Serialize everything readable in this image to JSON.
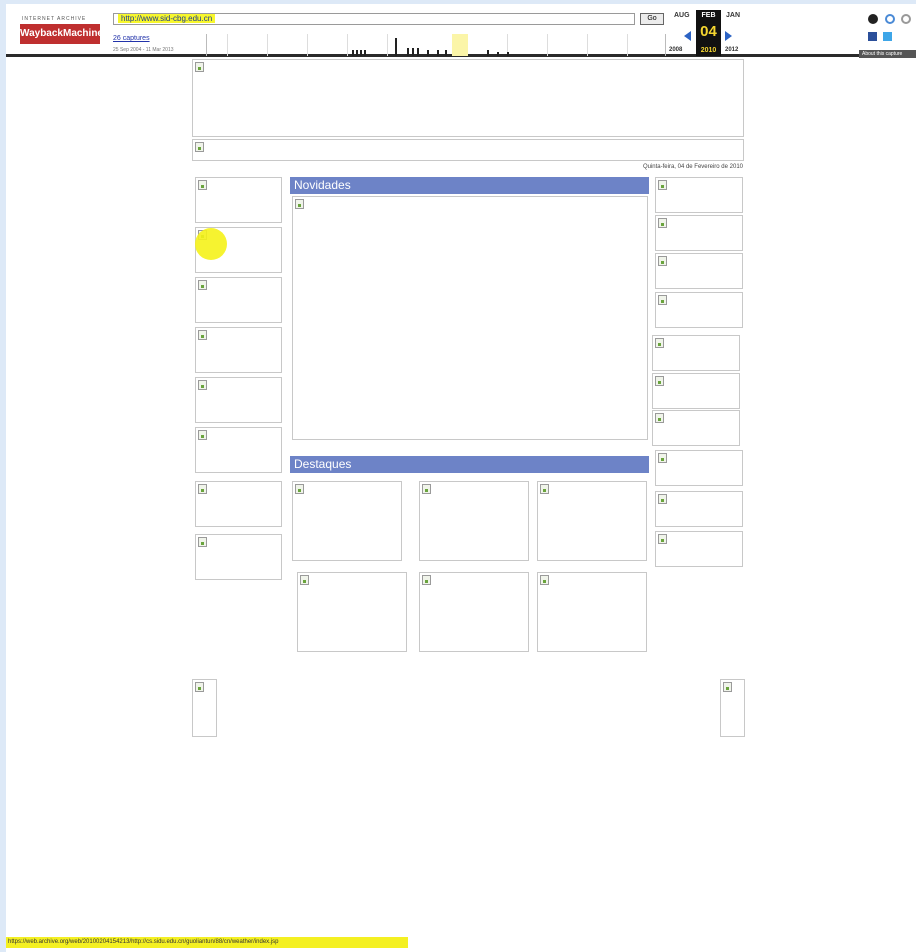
{
  "wayback": {
    "logo_small": "INTERNET ARCHIVE",
    "logo": "WaybackMachine",
    "url": "http://www.sid-cbg.edu.cn",
    "go_label": "Go",
    "captures": "26 captures",
    "range": "25 Sep 2004 - 11 Mar 2013",
    "prev_month": "AUG",
    "cur_month": "FEB",
    "next_month": "JAN",
    "cur_day": "04",
    "prev_year": "2008",
    "cur_year": "2010",
    "next_year": "2012",
    "about": "About this capture",
    "icons": [
      "user-icon",
      "help-icon",
      "close-icon",
      "facebook-icon",
      "twitter-icon"
    ]
  },
  "page": {
    "date": "Quinta-feira, 04 de Fevereiro de 2010",
    "novidades": "Novidades",
    "destaques": "Destaques"
  },
  "status_bar": {
    "text": "https://web.archive.org/web/20100204154213/http://cs.sidu.edu.cn/guoliantun/88/cn/weather/index.jsp"
  },
  "colors": {
    "section_header": "#6d83c7",
    "highlight": "#f5f21a",
    "wayback_red": "#bf2f2f"
  }
}
